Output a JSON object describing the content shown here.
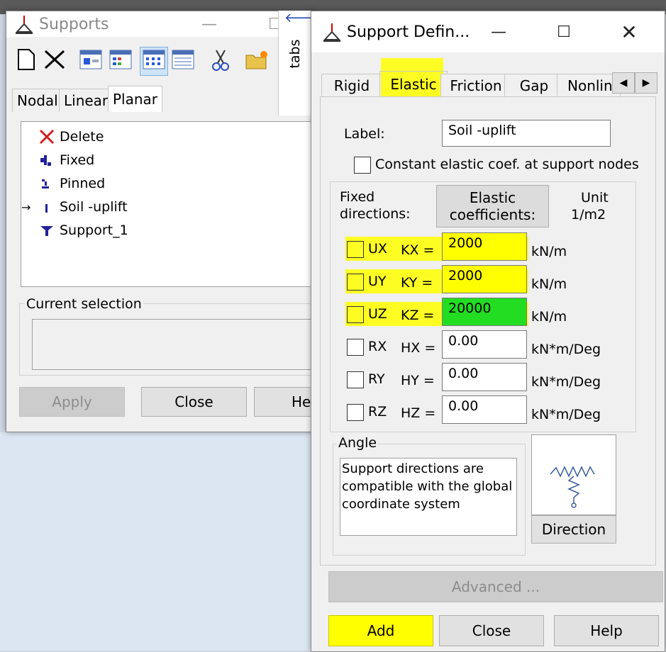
{
  "supports_window": {
    "title": "Supports",
    "tabs": [
      "Nodal",
      "Linear",
      "Planar"
    ],
    "list_items": [
      {
        "label": "Delete",
        "icon": "delete-x-icon"
      },
      {
        "label": "Fixed",
        "icon": "fixed-support-icon"
      },
      {
        "label": "Pinned",
        "icon": "pinned-support-icon"
      },
      {
        "label": "Soil -uplift",
        "icon": "soil-support-icon",
        "current": true
      },
      {
        "label": "Support_1",
        "icon": "support-1-icon"
      }
    ],
    "current_selection_label": "Current selection",
    "buttons": {
      "apply": "Apply",
      "close": "Close",
      "help": "Help"
    },
    "side_tab": "tabs"
  },
  "definition_window": {
    "title": "Support Defin...",
    "tabs": [
      "Rigid",
      "Elastic",
      "Friction",
      "Gap",
      "Nonline"
    ],
    "label_caption": "Label:",
    "label_value": "Soil -uplift",
    "constant_coef_label": "Constant elastic coef. at support nodes",
    "fixed_directions_label": "Fixed directions:",
    "elastic_coef_button": "Elastic coefficients:",
    "unit_header": "Unit",
    "unit_value": "1/m2",
    "rows": [
      {
        "dir": "UX",
        "coef": "KX =",
        "value": "2000",
        "unit": "kN/m"
      },
      {
        "dir": "UY",
        "coef": "KY =",
        "value": "2000",
        "unit": "kN/m"
      },
      {
        "dir": "UZ",
        "coef": "KZ =",
        "value": "20000",
        "unit": "kN/m"
      },
      {
        "dir": "RX",
        "coef": "HX =",
        "value": "0.00",
        "unit": "kN*m/Deg"
      },
      {
        "dir": "RY",
        "coef": "HY =",
        "value": "0.00",
        "unit": "kN*m/Deg"
      },
      {
        "dir": "RZ",
        "coef": "HZ =",
        "value": "0.00",
        "unit": "kN*m/Deg"
      }
    ],
    "angle_label": "Angle",
    "angle_text": "Support directions are compatible with the global coordinate system",
    "direction_button": "Direction",
    "advanced_button": "Advanced ...",
    "buttons": {
      "add": "Add",
      "close": "Close",
      "help": "Help"
    }
  },
  "colors": {
    "highlight_yellow": "#ffff00",
    "active_green": "#22dd22"
  }
}
